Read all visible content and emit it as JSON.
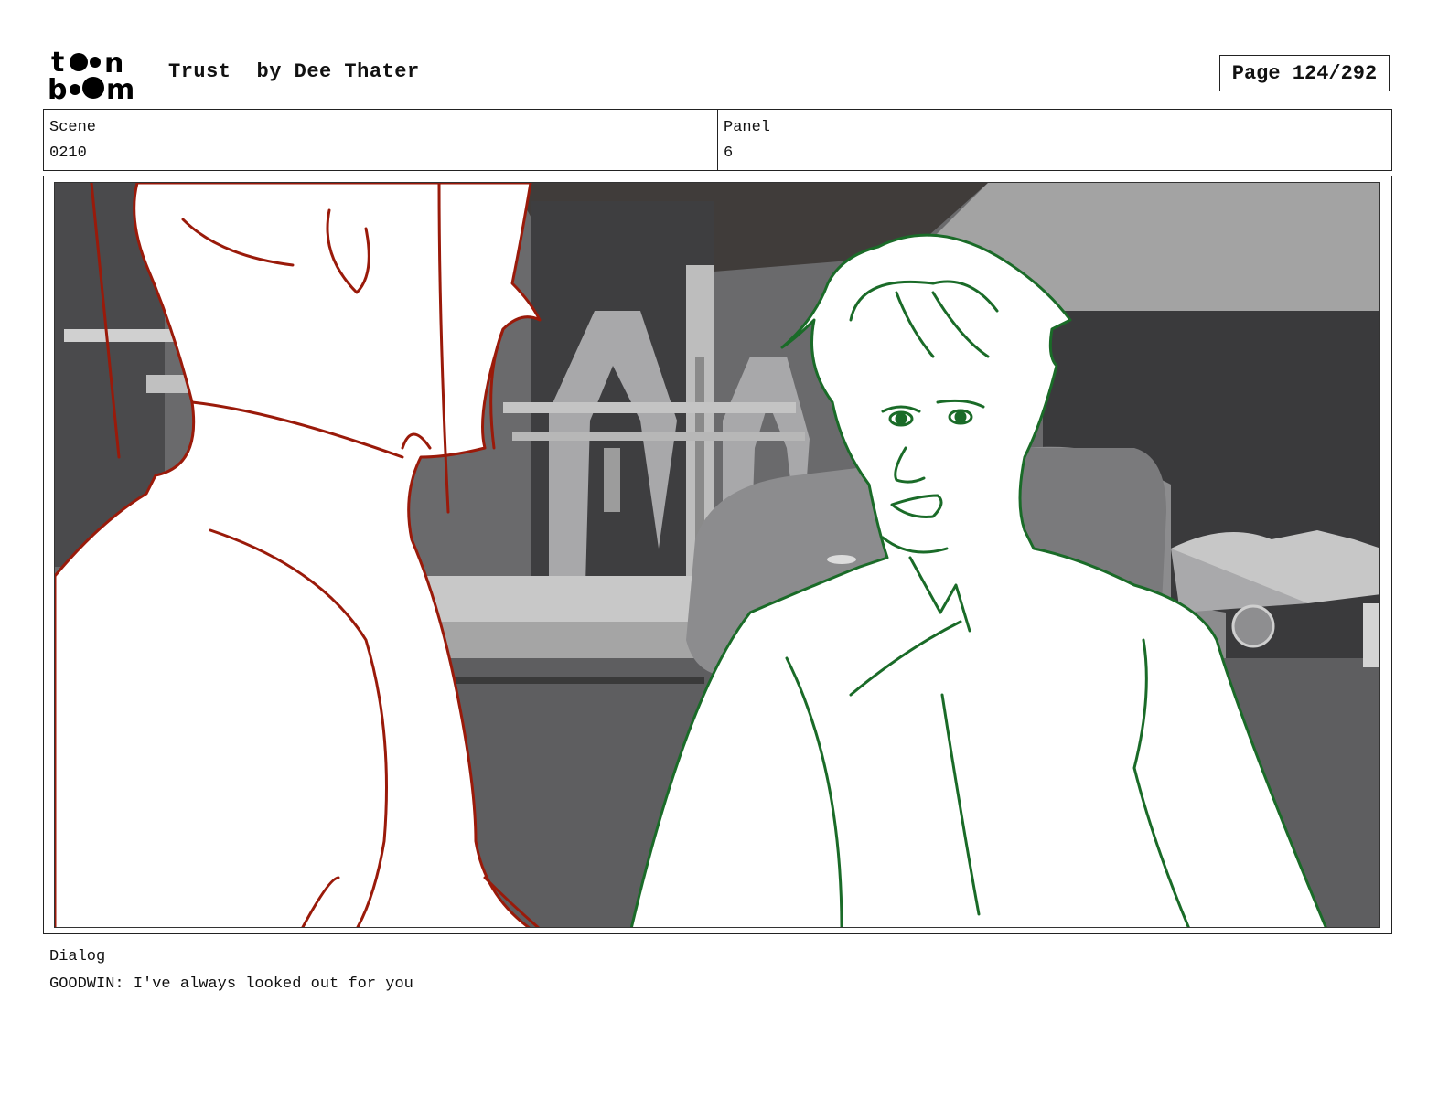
{
  "header": {
    "logo_text": "toon boom",
    "title": "Trust",
    "author": "by Dee Thater",
    "page_label": "Page 124/292"
  },
  "info": {
    "scene_label": "Scene",
    "scene_value": "0210",
    "panel_label": "Panel",
    "panel_value": "6"
  },
  "dialog": {
    "label": "Dialog",
    "text": "GOODWIN: I've always looked out for you"
  },
  "colors": {
    "foreground_character_line": "#9a1a0a",
    "background_character_line": "#1a6b28",
    "background_gray": "#6a6a6c"
  }
}
